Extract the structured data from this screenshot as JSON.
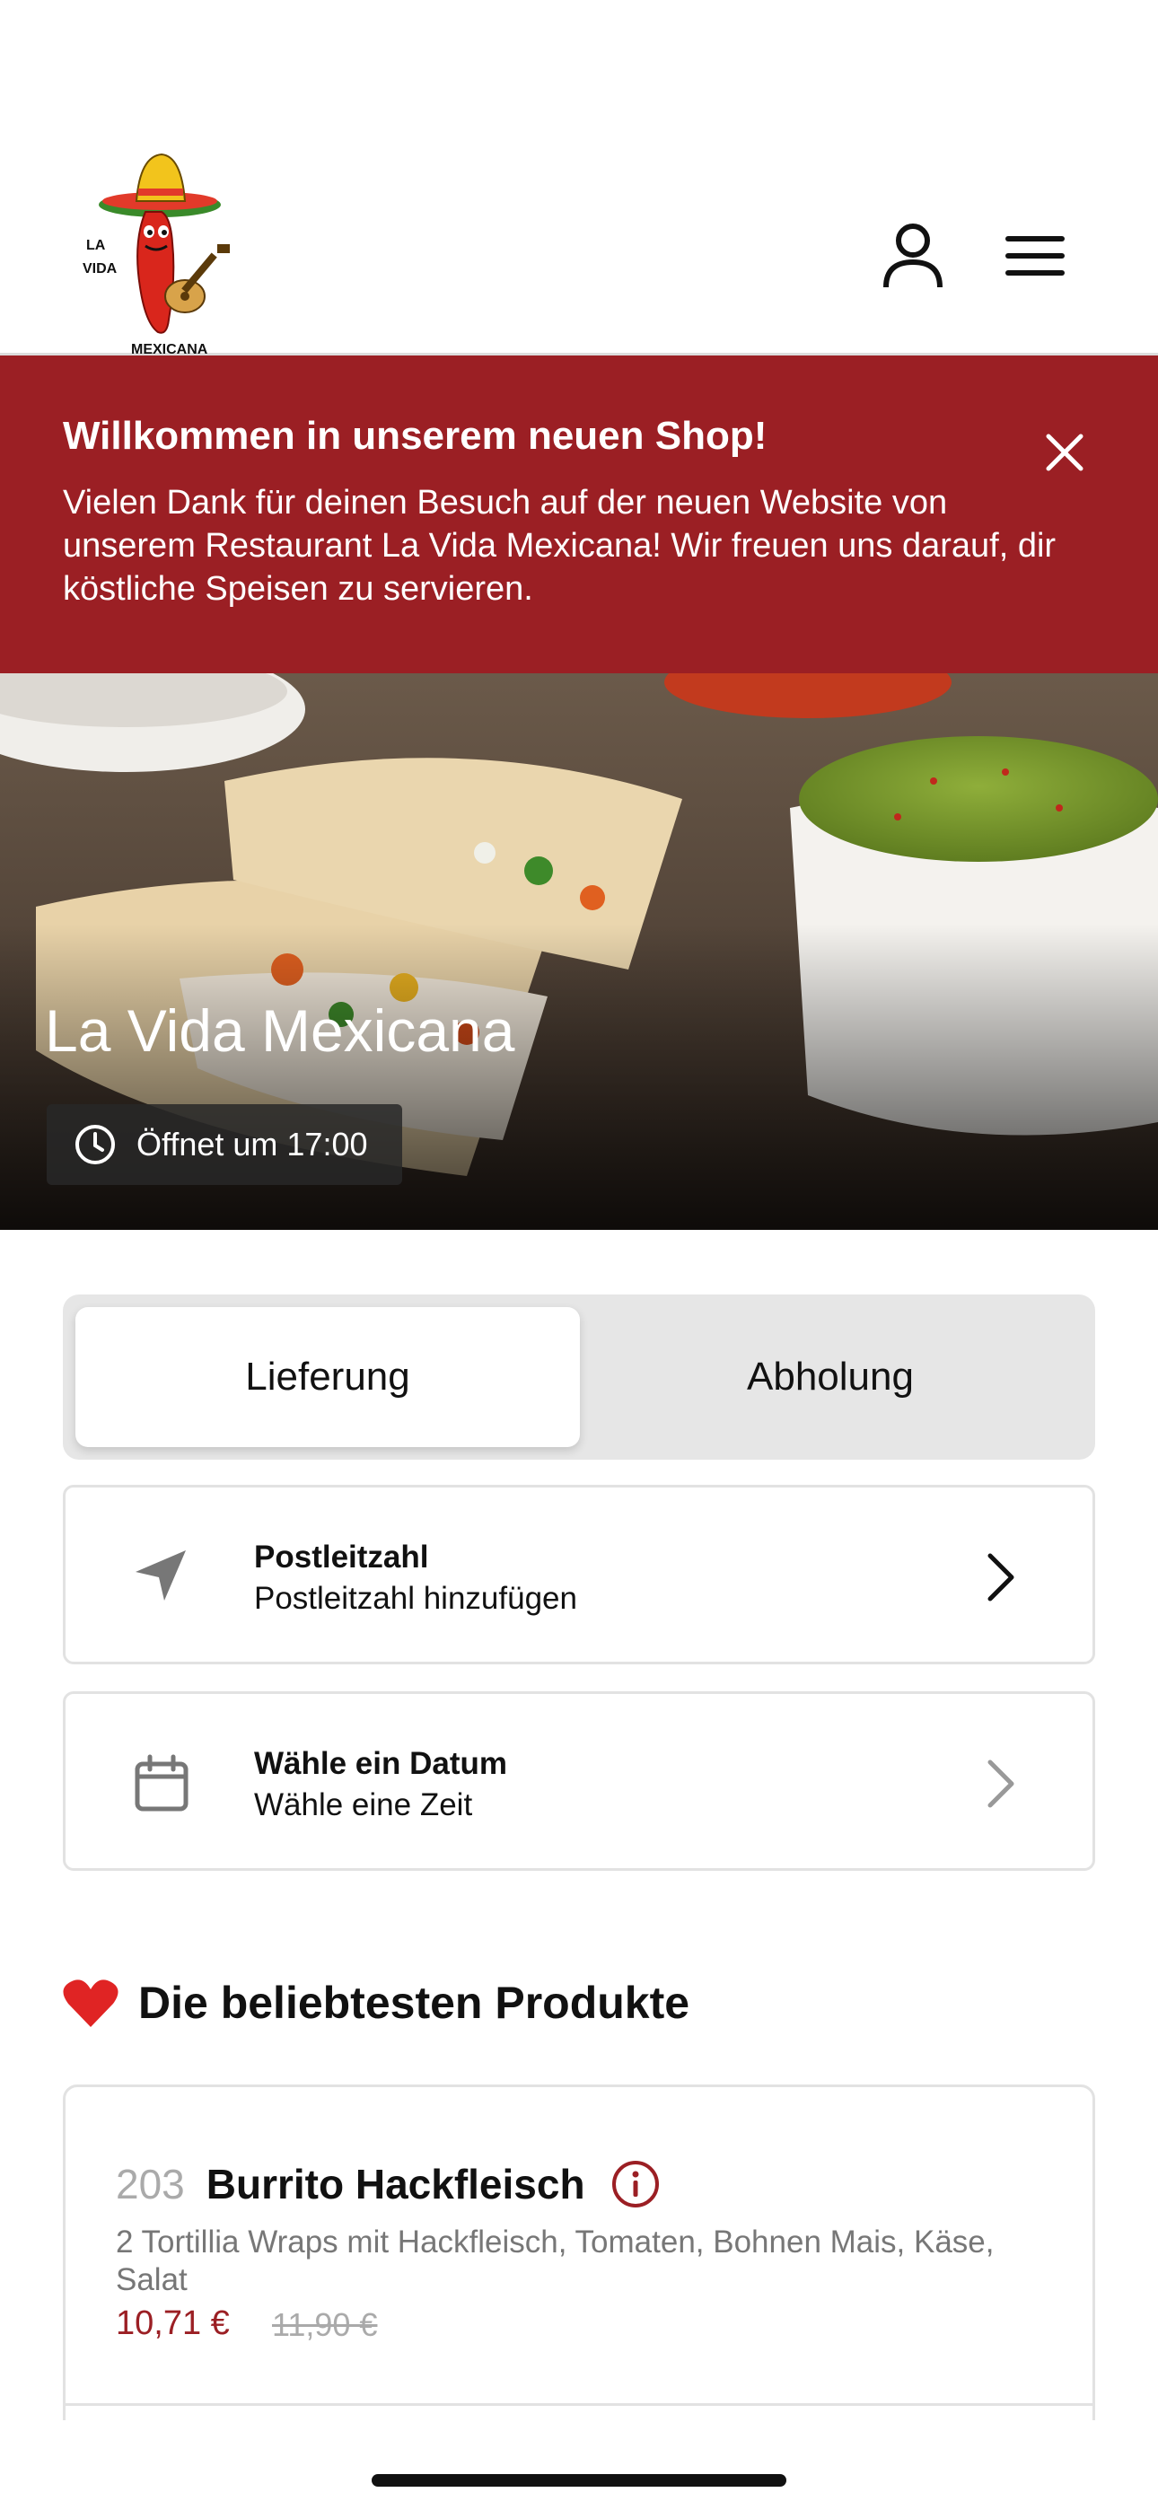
{
  "logo": {
    "line1": "LA",
    "line2": "VIDA",
    "line3": "MEXICANA"
  },
  "banner": {
    "title": "Willkommen in unserem neuen Shop!",
    "text": "Vielen Dank für deinen Besuch auf der neuen Website von unserem Restaurant La Vida Mexicana! Wir freuen uns darauf, dir köstliche Speisen zu servieren."
  },
  "hero": {
    "title": "La Vida Mexicana",
    "hours": "Öffnet um 17:00"
  },
  "segment": {
    "delivery": "Lieferung",
    "pickup": "Abholung",
    "selected": "Lieferung"
  },
  "postcode": {
    "title": "Postleitzahl",
    "subtitle": "Postleitzahl hinzufügen"
  },
  "date": {
    "title": "Wähle ein Datum",
    "subtitle": "Wähle eine Zeit"
  },
  "popular": {
    "title": "Die beliebtesten Produkte",
    "items": [
      {
        "number": "203",
        "name": "Burrito Hackfleisch",
        "description": "2 Tortillia Wraps mit Hackfleisch, Tomaten, Bohnen Mais, Käse, Salat",
        "price": "10,71 €",
        "old_price": "11,90 €"
      }
    ]
  },
  "colors": {
    "brand_red": "#9b1f24",
    "info_red": "#9b1f24"
  },
  "icons": [
    "user-icon",
    "menu-icon",
    "close-icon",
    "clock-icon",
    "location-arrow-icon",
    "calendar-icon",
    "chevron-right-icon",
    "heart-icon",
    "info-icon"
  ]
}
